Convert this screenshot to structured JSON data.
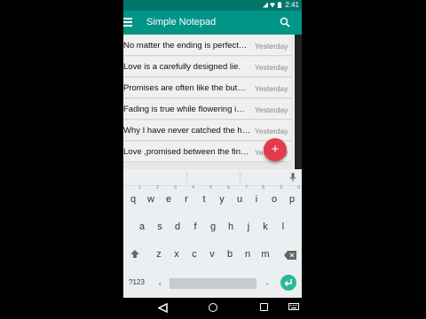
{
  "status_bar": {
    "time": "2:41"
  },
  "app_bar": {
    "title": "Simple Notepad"
  },
  "notes": [
    {
      "text": "No matter the ending is perfect…",
      "date": "Yesterday"
    },
    {
      "text": "Love is a carefully designed lie.",
      "date": "Yesterday"
    },
    {
      "text": "Promises are often like the but…",
      "date": "Yesterday"
    },
    {
      "text": "Fading is true while flowering i…",
      "date": "Yesterday"
    },
    {
      "text": "Why I have never catched the h…",
      "date": "Yesterday"
    },
    {
      "text": "Love ,promised between the fin…",
      "date": "Yesterday"
    }
  ],
  "fab": {
    "label": "+"
  },
  "keyboard": {
    "row1": [
      {
        "key": "q",
        "num": "1"
      },
      {
        "key": "w",
        "num": "2"
      },
      {
        "key": "e",
        "num": "3"
      },
      {
        "key": "r",
        "num": "4"
      },
      {
        "key": "t",
        "num": "5"
      },
      {
        "key": "y",
        "num": "6"
      },
      {
        "key": "u",
        "num": "7"
      },
      {
        "key": "i",
        "num": "8"
      },
      {
        "key": "o",
        "num": "9"
      },
      {
        "key": "p",
        "num": "0"
      }
    ],
    "row2": [
      "a",
      "s",
      "d",
      "f",
      "g",
      "h",
      "j",
      "k",
      "l"
    ],
    "row3": [
      "z",
      "x",
      "c",
      "v",
      "b",
      "n",
      "m"
    ],
    "row4": {
      "symbols": "?123",
      "comma": ",",
      "period": "."
    }
  },
  "colors": {
    "app_bar": "#009587",
    "status_bar": "#00766a",
    "fab": "#e33a4e",
    "enter_key": "#2bb79a"
  }
}
